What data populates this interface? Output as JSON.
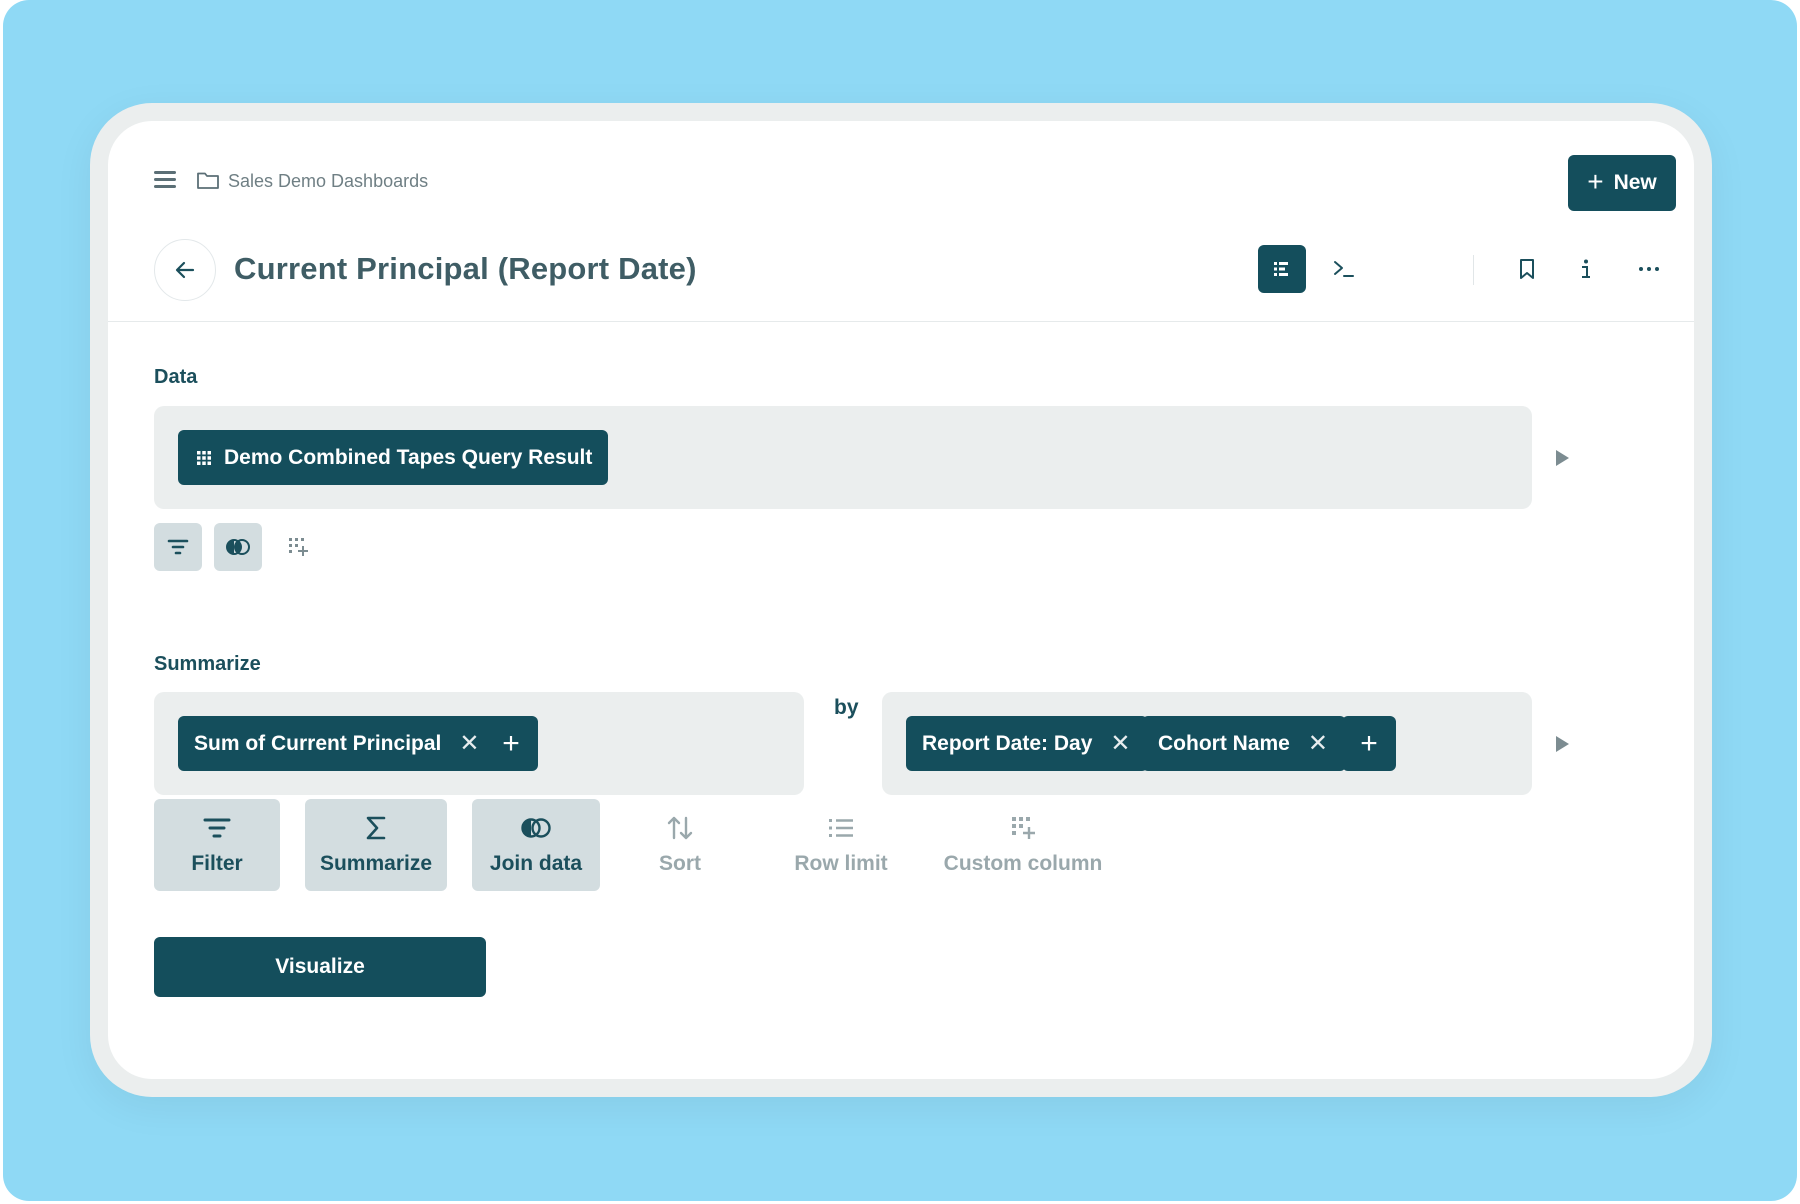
{
  "topbar": {
    "breadcrumb": "Sales Demo Dashboards",
    "new_label": "New"
  },
  "header": {
    "title": "Current Principal (Report Date)",
    "icons": [
      "notebook-icon",
      "sql-editor-icon",
      "bookmark-icon",
      "info-icon",
      "more-icon"
    ]
  },
  "data_section": {
    "label": "Data",
    "source": "Demo Combined Tapes Query Result"
  },
  "summarize_section": {
    "label": "Summarize",
    "metrics": [
      "Sum of Current Principal"
    ],
    "by_label": "by",
    "breakouts": [
      "Report Date: Day",
      "Cohort Name"
    ]
  },
  "actions": {
    "filter": "Filter",
    "summarize": "Summarize",
    "join": "Join data",
    "sort": "Sort",
    "row_limit": "Row limit",
    "custom_column": "Custom column"
  },
  "visualize_label": "Visualize",
  "colors": {
    "primary": "#144e5c",
    "backdrop": "#8fd9f5",
    "panel": "#ebeeee",
    "muted": "#9aa8ac"
  }
}
